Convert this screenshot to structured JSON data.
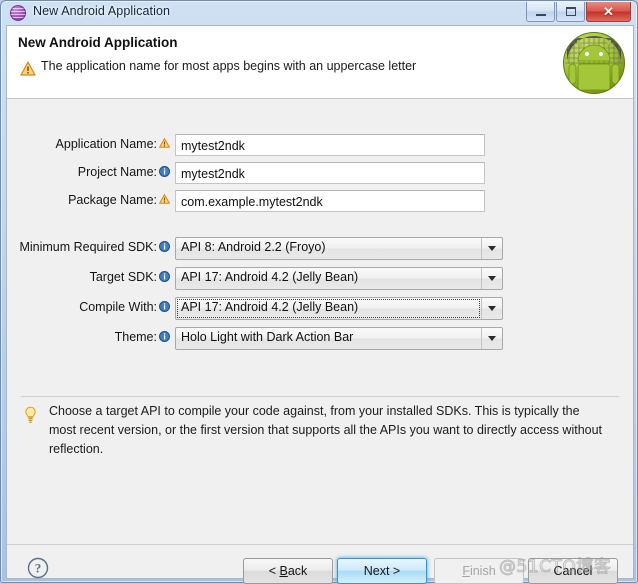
{
  "window": {
    "title": "New Android Application",
    "icon": "android-sphere-icon",
    "controls": {
      "minimize": "minimize-button",
      "maximize": "restore-button",
      "close": "close-button"
    }
  },
  "header": {
    "title": "New Android Application",
    "message": "The application name for most apps begins with an uppercase letter",
    "message_icon": "warning-icon",
    "logo": "android-robot-logo"
  },
  "form": {
    "text_fields": [
      {
        "label": "Application Name:",
        "icon": "warning-icon",
        "value": "mytest2ndk"
      },
      {
        "label": "Project Name:",
        "icon": "info-icon",
        "value": "mytest2ndk"
      },
      {
        "label": "Package Name:",
        "icon": "warning-icon",
        "value": "com.example.mytest2ndk"
      }
    ],
    "dropdowns": [
      {
        "label": "Minimum Required SDK:",
        "icon": "info-icon",
        "value": "API 8: Android 2.2 (Froyo)",
        "focused": false
      },
      {
        "label": "Target SDK:",
        "icon": "info-icon",
        "value": "API 17: Android 4.2 (Jelly Bean)",
        "focused": false
      },
      {
        "label": "Compile With:",
        "icon": "info-icon",
        "value": "API 17: Android 4.2 (Jelly Bean)",
        "focused": true
      },
      {
        "label": "Theme:",
        "icon": "info-icon",
        "value": "Holo Light with Dark Action Bar",
        "focused": false
      }
    ]
  },
  "tip": {
    "icon": "lightbulb-icon",
    "text": "Choose a target API to compile your code against, from your installed SDKs. This is typically the most recent version, or the first version that supports all the APIs you want to directly access without reflection."
  },
  "footer": {
    "help_icon": "help-question-icon",
    "buttons": [
      {
        "name": "back-button",
        "label": "< Back",
        "mnemonic": "B",
        "state": "enabled"
      },
      {
        "name": "next-button",
        "label": "Next >",
        "mnemonic": "",
        "state": "default"
      },
      {
        "name": "finish-button",
        "label": "Finish",
        "mnemonic": "F",
        "state": "disabled"
      },
      {
        "name": "cancel-button",
        "label": "Cancel",
        "mnemonic": "",
        "state": "enabled"
      }
    ]
  },
  "watermark": {
    "text": "@51CTO博客"
  },
  "colors": {
    "titlebar": "#c6daf0",
    "dialog_bg": "#f0f0f0",
    "header_bg": "#ffffff",
    "accent_primary": "#3c93c8",
    "close_button": "#d9564c",
    "android_green": "#a4c639",
    "warning_yellow": "#f0a830",
    "info_blue": "#2a6fb5"
  }
}
